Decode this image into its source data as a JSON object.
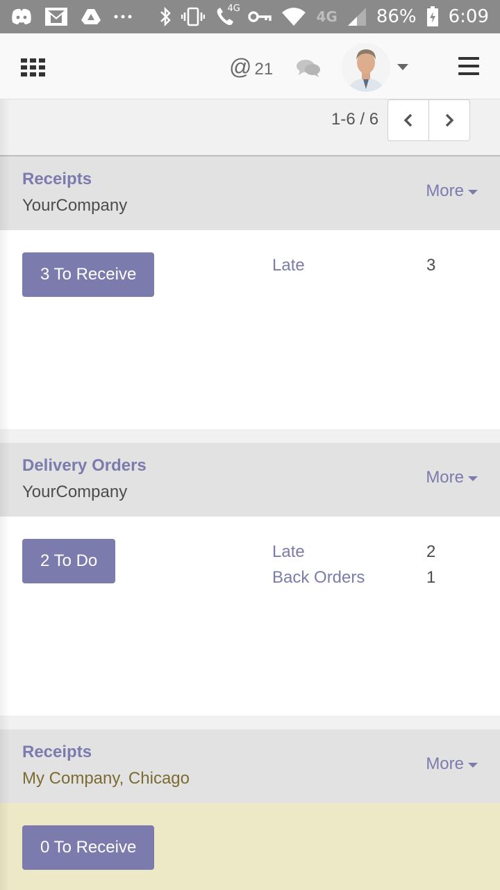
{
  "status_bar": {
    "battery": "86%",
    "time": "6:09",
    "network_small": "4G",
    "network": "4G",
    "icons": [
      "discord-icon",
      "gmail-icon",
      "drive-icon",
      "more-dots-icon",
      "bluetooth-icon",
      "vibrate-icon",
      "wifi-call-icon",
      "vpn-key-icon",
      "wifi-icon",
      "signal-icon",
      "battery-icon"
    ]
  },
  "topnav": {
    "mention_symbol": "@",
    "mention_count": "21"
  },
  "pager": {
    "value": "1-6 / 6"
  },
  "cards": [
    {
      "title": "Receipts",
      "company": "YourCompany",
      "more": "More",
      "action": "3 To Receive",
      "stats": [
        {
          "label": "Late",
          "value": "3"
        }
      ]
    },
    {
      "title": "Delivery Orders",
      "company": "YourCompany",
      "more": "More",
      "action": "2 To Do",
      "stats": [
        {
          "label": "Late",
          "value": "2"
        },
        {
          "label": "Back Orders",
          "value": "1"
        }
      ]
    },
    {
      "title": "Receipts",
      "company": "My Company, Chicago",
      "more": "More",
      "action": "0 To Receive",
      "stats": []
    }
  ],
  "colors": {
    "accent": "#7c7bad",
    "warning_bg": "#ede9c6",
    "statusbar": "#8a8a8a"
  }
}
